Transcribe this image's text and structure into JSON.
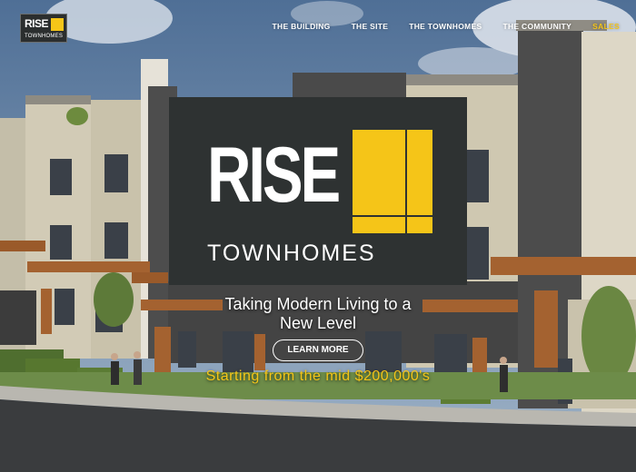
{
  "logo": {
    "word": "RISE",
    "sub": "TOWNHOMES"
  },
  "nav": [
    {
      "label": "THE BUILDING",
      "key": "building"
    },
    {
      "label": "THE SITE",
      "key": "site"
    },
    {
      "label": "THE TOWNHOMES",
      "key": "townhomes"
    },
    {
      "label": "THE COMMUNITY",
      "key": "community"
    },
    {
      "label": "SALES",
      "key": "sales"
    }
  ],
  "hero": {
    "brand_word": "RISE",
    "brand_sub": "TOWNHOMES",
    "tagline_line1": "Taking Modern Living to a",
    "tagline_line2": "New Level",
    "button_label": "LEARN MORE",
    "price_text": "Starting from the mid $200,000's"
  },
  "colors": {
    "accent": "#f5c518",
    "panel": "#2e3232"
  }
}
